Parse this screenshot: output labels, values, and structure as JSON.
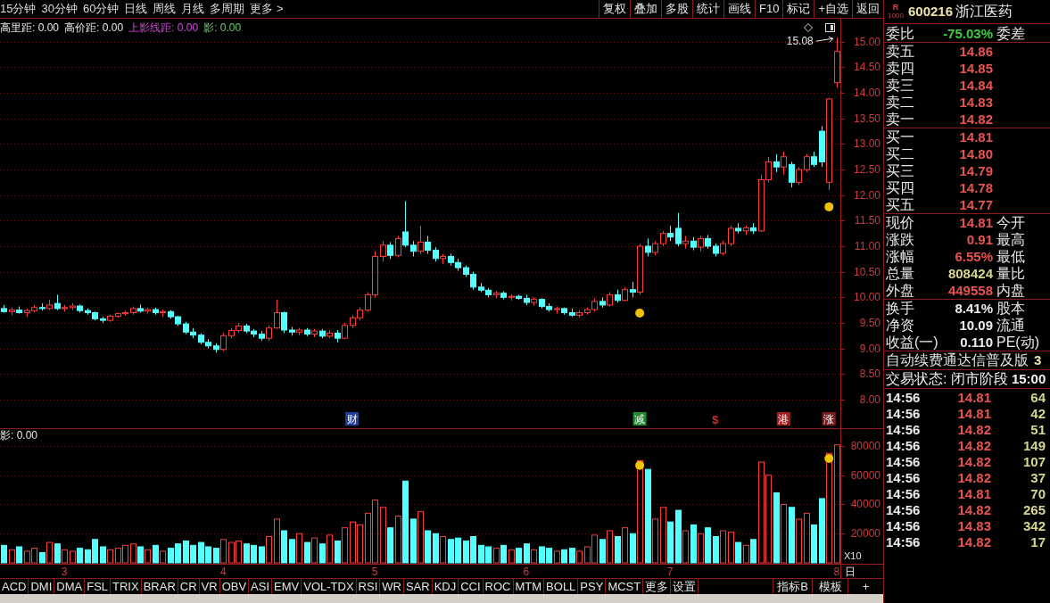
{
  "toolbar": {
    "period_tabs": [
      "15分钟",
      "30分钟",
      "60分钟",
      "日线",
      "周线",
      "月线",
      "多周期",
      "更多 >"
    ],
    "buttons": [
      "复权",
      "叠加",
      "多股",
      "统计",
      "画线",
      "F10",
      "标记",
      "+自选",
      "返回"
    ]
  },
  "indicator_line": [
    {
      "label": "高里距:",
      "value": "0.00",
      "color": "#e6e6e6"
    },
    {
      "label": "高价距:",
      "value": "0.00",
      "color": "#e6e6e6"
    },
    {
      "label": "上影线距:",
      "value": "0.00",
      "color": "#d048d8"
    },
    {
      "label": "影:",
      "value": "0.00",
      "color": "#6cc86c"
    }
  ],
  "volume_indicator": {
    "label": "影:",
    "value": "0.00"
  },
  "chart": {
    "chart_data": [
      {
        "type": "candlestick",
        "grid": true,
        "ylim": [
          7.44,
          15.45
        ],
        "yticks": [
          {
            "value": 8,
            "label": "8.00"
          },
          {
            "value": 8.5,
            "label": "8.50"
          },
          {
            "value": 9,
            "label": "9.00"
          },
          {
            "value": 9.5,
            "label": "9.50"
          },
          {
            "value": 10,
            "label": "10.00"
          },
          {
            "value": 10.5,
            "label": "10.50"
          },
          {
            "value": 11,
            "label": "11.00"
          },
          {
            "value": 11.5,
            "label": "11.50"
          },
          {
            "value": 12,
            "label": "12.00"
          },
          {
            "value": 12.5,
            "label": "12.50"
          },
          {
            "value": 13,
            "label": "13.00"
          },
          {
            "value": 13.5,
            "label": "13.50"
          },
          {
            "value": 14,
            "label": "14.00"
          },
          {
            "value": 14.5,
            "label": "14.50"
          },
          {
            "value": 15,
            "label": "15.00"
          }
        ],
        "categories": [
          null,
          null,
          null,
          null,
          null,
          null,
          null,
          null,
          null,
          null,
          null,
          null,
          null,
          null,
          null,
          null,
          null,
          null,
          null,
          null,
          null,
          null,
          null,
          null,
          null,
          null,
          null,
          null,
          null,
          null,
          null,
          null,
          null,
          null,
          null,
          null,
          null,
          null,
          null,
          null,
          null,
          null,
          null,
          null,
          null,
          null,
          "财",
          null,
          null,
          null,
          null,
          null,
          null,
          null,
          null,
          null,
          null,
          null,
          null,
          null,
          null,
          null,
          null,
          null,
          null,
          null,
          null,
          null,
          null,
          null,
          null,
          null,
          null,
          null,
          null,
          null,
          null,
          null,
          null,
          null,
          null,
          null,
          null,
          null,
          "减",
          null,
          null,
          null,
          null,
          null,
          null,
          null,
          null,
          null,
          "$",
          null,
          null,
          null,
          null,
          null,
          null,
          null,
          null,
          "港",
          null,
          null,
          null,
          null,
          null,
          "涨",
          null
        ],
        "ohlc": [
          [
            9.78,
            9.85,
            9.7,
            9.72
          ],
          [
            9.72,
            9.8,
            9.65,
            9.75
          ],
          [
            9.75,
            9.82,
            9.68,
            9.7
          ],
          [
            9.7,
            9.78,
            9.62,
            9.74
          ],
          [
            9.74,
            9.85,
            9.7,
            9.8
          ],
          [
            9.8,
            9.88,
            9.74,
            9.78
          ],
          [
            9.78,
            9.95,
            9.75,
            9.85
          ],
          [
            9.88,
            10.05,
            9.75,
            9.78
          ],
          [
            9.78,
            9.85,
            9.72,
            9.8
          ],
          [
            9.8,
            9.88,
            9.75,
            9.83
          ],
          [
            9.83,
            9.86,
            9.7,
            9.74
          ],
          [
            9.74,
            9.78,
            9.66,
            9.7
          ],
          [
            9.7,
            9.72,
            9.55,
            9.58
          ],
          [
            9.58,
            9.62,
            9.5,
            9.55
          ],
          [
            9.55,
            9.66,
            9.52,
            9.63
          ],
          [
            9.63,
            9.7,
            9.6,
            9.68
          ],
          [
            9.68,
            9.74,
            9.64,
            9.7
          ],
          [
            9.7,
            9.82,
            9.66,
            9.78
          ],
          [
            9.78,
            9.86,
            9.7,
            9.73
          ],
          [
            9.73,
            9.8,
            9.68,
            9.76
          ],
          [
            9.76,
            9.8,
            9.66,
            9.7
          ],
          [
            9.7,
            9.76,
            9.62,
            9.72
          ],
          [
            9.72,
            9.75,
            9.58,
            9.62
          ],
          [
            9.62,
            9.64,
            9.44,
            9.48
          ],
          [
            9.48,
            9.52,
            9.28,
            9.32
          ],
          [
            9.32,
            9.4,
            9.2,
            9.26
          ],
          [
            9.26,
            9.3,
            9.08,
            9.12
          ],
          [
            9.12,
            9.18,
            9.0,
            9.05
          ],
          [
            9.05,
            9.1,
            8.92,
            8.98
          ],
          [
            8.98,
            9.3,
            8.95,
            9.25
          ],
          [
            9.25,
            9.4,
            9.2,
            9.35
          ],
          [
            9.35,
            9.5,
            9.3,
            9.44
          ],
          [
            9.44,
            9.48,
            9.3,
            9.34
          ],
          [
            9.34,
            9.38,
            9.22,
            9.28
          ],
          [
            9.28,
            9.34,
            9.15,
            9.2
          ],
          [
            9.2,
            9.45,
            9.15,
            9.4
          ],
          [
            9.4,
            9.95,
            9.38,
            9.7
          ],
          [
            9.7,
            9.72,
            9.3,
            9.36
          ],
          [
            9.36,
            9.42,
            9.25,
            9.32
          ],
          [
            9.32,
            9.4,
            9.26,
            9.36
          ],
          [
            9.36,
            9.4,
            9.24,
            9.28
          ],
          [
            9.28,
            9.38,
            9.22,
            9.34
          ],
          [
            9.34,
            9.38,
            9.2,
            9.24
          ],
          [
            9.24,
            9.36,
            9.2,
            9.3
          ],
          [
            9.3,
            9.36,
            9.12,
            9.2
          ],
          [
            9.2,
            9.5,
            9.18,
            9.45
          ],
          [
            9.45,
            9.65,
            9.4,
            9.6
          ],
          [
            9.6,
            9.8,
            9.55,
            9.75
          ],
          [
            9.75,
            10.1,
            9.72,
            10.05
          ],
          [
            10.05,
            10.9,
            10.0,
            10.8
          ],
          [
            10.8,
            11.1,
            10.7,
            11.02
          ],
          [
            11.02,
            11.08,
            10.75,
            10.82
          ],
          [
            10.82,
            11.2,
            10.78,
            11.15
          ],
          [
            11.28,
            11.88,
            10.98,
            11.02
          ],
          [
            11.02,
            11.1,
            10.8,
            10.9
          ],
          [
            10.9,
            11.4,
            10.85,
            11.08
          ],
          [
            11.08,
            11.2,
            10.85,
            10.92
          ],
          [
            10.92,
            10.98,
            10.7,
            10.76
          ],
          [
            10.76,
            10.85,
            10.65,
            10.8
          ],
          [
            10.8,
            10.85,
            10.62,
            10.68
          ],
          [
            10.68,
            10.75,
            10.52,
            10.58
          ],
          [
            10.58,
            10.62,
            10.4,
            10.45
          ],
          [
            10.45,
            10.5,
            10.15,
            10.2
          ],
          [
            10.2,
            10.28,
            10.1,
            10.14
          ],
          [
            10.14,
            10.18,
            10.0,
            10.05
          ],
          [
            10.05,
            10.12,
            9.98,
            10.08
          ],
          [
            10.08,
            10.12,
            9.96,
            10.0
          ],
          [
            10.0,
            10.06,
            9.94,
            10.02
          ],
          [
            10.02,
            10.05,
            9.95,
            9.98
          ],
          [
            9.98,
            10.05,
            9.85,
            9.9
          ],
          [
            9.9,
            10.0,
            9.84,
            9.96
          ],
          [
            9.96,
            9.98,
            9.78,
            9.82
          ],
          [
            9.82,
            9.88,
            9.72,
            9.76
          ],
          [
            9.76,
            9.82,
            9.68,
            9.78
          ],
          [
            9.78,
            9.8,
            9.66,
            9.7
          ],
          [
            9.7,
            9.78,
            9.62,
            9.65
          ],
          [
            9.65,
            9.75,
            9.6,
            9.7
          ],
          [
            9.7,
            9.8,
            9.66,
            9.76
          ],
          [
            9.76,
            9.98,
            9.72,
            9.92
          ],
          [
            9.92,
            10.0,
            9.8,
            9.85
          ],
          [
            9.85,
            10.1,
            9.82,
            10.05
          ],
          [
            10.05,
            10.15,
            9.9,
            9.94
          ],
          [
            9.94,
            10.2,
            9.92,
            10.15
          ],
          [
            10.15,
            10.3,
            10.0,
            10.1
          ],
          [
            10.1,
            11.05,
            10.05,
            11.0
          ],
          [
            11.0,
            11.15,
            10.8,
            10.88
          ],
          [
            10.88,
            11.1,
            10.82,
            11.05
          ],
          [
            11.05,
            11.3,
            11.0,
            11.25
          ],
          [
            11.25,
            11.4,
            11.1,
            11.18
          ],
          [
            11.35,
            11.65,
            11.0,
            11.05
          ],
          [
            11.05,
            11.2,
            10.95,
            11.1
          ],
          [
            11.1,
            11.18,
            10.92,
            10.98
          ],
          [
            10.98,
            11.2,
            10.9,
            11.15
          ],
          [
            11.15,
            11.22,
            10.95,
            11.0
          ],
          [
            11.0,
            11.05,
            10.8,
            10.86
          ],
          [
            10.86,
            11.1,
            10.82,
            11.05
          ],
          [
            11.05,
            11.4,
            11.0,
            11.35
          ],
          [
            11.35,
            11.45,
            11.25,
            11.3
          ],
          [
            11.3,
            11.4,
            11.22,
            11.36
          ],
          [
            11.36,
            11.45,
            11.24,
            11.3
          ],
          [
            11.3,
            12.4,
            11.28,
            12.3
          ],
          [
            12.3,
            12.75,
            12.25,
            12.65
          ],
          [
            12.65,
            12.8,
            12.45,
            12.55
          ],
          [
            12.55,
            12.85,
            12.4,
            12.75
          ],
          [
            12.6,
            12.65,
            12.15,
            12.25
          ],
          [
            12.25,
            12.55,
            12.2,
            12.5
          ],
          [
            12.5,
            12.8,
            12.45,
            12.75
          ],
          [
            12.75,
            12.85,
            12.55,
            12.6
          ],
          [
            13.25,
            13.35,
            12.55,
            12.65
          ],
          [
            12.25,
            13.9,
            12.1,
            13.88
          ],
          [
            14.2,
            15.08,
            14.1,
            14.81
          ]
        ],
        "series": [
          {
            "type": "scatter",
            "marker": "circle",
            "color": "#f2c200",
            "values": [
              null,
              null,
              null,
              null,
              null,
              null,
              null,
              null,
              null,
              null,
              null,
              null,
              null,
              null,
              null,
              null,
              null,
              null,
              null,
              null,
              null,
              null,
              null,
              null,
              null,
              null,
              null,
              null,
              null,
              null,
              null,
              null,
              null,
              null,
              null,
              null,
              null,
              null,
              null,
              null,
              null,
              null,
              null,
              null,
              null,
              null,
              null,
              null,
              null,
              null,
              null,
              null,
              null,
              null,
              null,
              null,
              null,
              null,
              null,
              null,
              null,
              null,
              null,
              null,
              null,
              null,
              null,
              null,
              null,
              null,
              null,
              null,
              null,
              null,
              null,
              null,
              null,
              null,
              null,
              null,
              null,
              null,
              null,
              null,
              9.69,
              null,
              null,
              null,
              null,
              null,
              null,
              null,
              null,
              null,
              null,
              null,
              null,
              null,
              null,
              null,
              null,
              null,
              null,
              null,
              null,
              null,
              null,
              null,
              null,
              11.77,
              null
            ]
          }
        ],
        "annotations": [
          "15.08"
        ]
      },
      {
        "type": "bar",
        "grid": true,
        "ylim": [
          0,
          91603
        ],
        "ylabel": "X10",
        "yticks": [
          {
            "value": 20000,
            "label": "20000"
          },
          {
            "value": 40000,
            "label": "40000"
          },
          {
            "value": 60000,
            "label": "60000"
          },
          {
            "value": 80000,
            "label": "80000"
          }
        ],
        "categories": [
          null,
          null,
          null,
          null,
          null,
          null,
          null,
          null,
          "3",
          null,
          null,
          null,
          null,
          null,
          null,
          null,
          null,
          null,
          null,
          null,
          null,
          null,
          null,
          null,
          null,
          null,
          null,
          null,
          null,
          "4",
          null,
          null,
          null,
          null,
          null,
          null,
          null,
          null,
          null,
          null,
          null,
          null,
          null,
          null,
          null,
          null,
          null,
          null,
          null,
          "5",
          null,
          null,
          null,
          null,
          null,
          null,
          null,
          null,
          null,
          null,
          null,
          null,
          null,
          null,
          null,
          null,
          null,
          null,
          null,
          "6",
          null,
          null,
          null,
          null,
          null,
          null,
          null,
          null,
          null,
          null,
          null,
          null,
          null,
          null,
          null,
          null,
          null,
          null,
          "7",
          null,
          null,
          null,
          null,
          null,
          null,
          null,
          null,
          null,
          null,
          null,
          null,
          null,
          null,
          null,
          null,
          null,
          null,
          null,
          null,
          null,
          "8"
        ],
        "values": [
          12000,
          9000,
          11000,
          8000,
          10000,
          7000,
          14000,
          13000,
          9000,
          8000,
          10000,
          9000,
          16000,
          11000,
          9000,
          10000,
          12000,
          13000,
          11000,
          9000,
          12000,
          8000,
          10000,
          13000,
          15000,
          12000,
          14000,
          11000,
          10000,
          16000,
          14000,
          15000,
          13000,
          12000,
          11000,
          18000,
          30000,
          22000,
          16000,
          20000,
          14000,
          17000,
          13000,
          19000,
          15000,
          24000,
          28000,
          26000,
          34000,
          43000,
          38000,
          24000,
          32000,
          56000,
          30000,
          35000,
          22000,
          20000,
          18000,
          16000,
          17000,
          15000,
          18000,
          12000,
          11000,
          10000,
          12000,
          9000,
          10000,
          13000,
          9000,
          11000,
          10000,
          8000,
          9000,
          10000,
          8000,
          11000,
          19000,
          16000,
          22000,
          18000,
          24000,
          20000,
          70000,
          64000,
          30000,
          38000,
          28000,
          36000,
          22000,
          26000,
          20000,
          24000,
          18000,
          22000,
          21000,
          14000,
          12000,
          16000,
          69000,
          60000,
          48000,
          40000,
          38000,
          30000,
          34000,
          26000,
          44000,
          75000,
          80800
        ],
        "colors": [
          "#54ffff",
          "#ff3c3c",
          "#54ffff",
          "#ff3c3c",
          "#ff3c3c",
          "#54ffff",
          "#ff3c3c",
          "#54ffff",
          "#ff3c3c",
          "#ff3c3c",
          "#54ffff",
          "#54ffff",
          "#54ffff",
          "#54ffff",
          "#ff3c3c",
          "#ff3c3c",
          "#ff3c3c",
          "#ff3c3c",
          "#54ffff",
          "#ff3c3c",
          "#54ffff",
          "#ff3c3c",
          "#54ffff",
          "#54ffff",
          "#54ffff",
          "#54ffff",
          "#54ffff",
          "#54ffff",
          "#54ffff",
          "#ff3c3c",
          "#ff3c3c",
          "#ff3c3c",
          "#54ffff",
          "#54ffff",
          "#54ffff",
          "#ff3c3c",
          "#ff3c3c",
          "#54ffff",
          "#54ffff",
          "#ff3c3c",
          "#54ffff",
          "#ff3c3c",
          "#54ffff",
          "#ff3c3c",
          "#54ffff",
          "#ff3c3c",
          "#ff3c3c",
          "#ff3c3c",
          "#ff3c3c",
          "#ff3c3c",
          "#ff3c3c",
          "#54ffff",
          "#ff3c3c",
          "#54ffff",
          "#54ffff",
          "#ff3c3c",
          "#54ffff",
          "#54ffff",
          "#ff3c3c",
          "#54ffff",
          "#54ffff",
          "#54ffff",
          "#54ffff",
          "#54ffff",
          "#54ffff",
          "#ff3c3c",
          "#54ffff",
          "#ff3c3c",
          "#54ffff",
          "#54ffff",
          "#ff3c3c",
          "#54ffff",
          "#54ffff",
          "#ff3c3c",
          "#54ffff",
          "#54ffff",
          "#ff3c3c",
          "#ff3c3c",
          "#ff3c3c",
          "#54ffff",
          "#ff3c3c",
          "#54ffff",
          "#ff3c3c",
          "#54ffff",
          "#ff3c3c",
          "#54ffff",
          "#ff3c3c",
          "#ff3c3c",
          "#54ffff",
          "#54ffff",
          "#ff3c3c",
          "#54ffff",
          "#ff3c3c",
          "#54ffff",
          "#54ffff",
          "#ff3c3c",
          "#ff3c3c",
          "#54ffff",
          "#ff3c3c",
          "#54ffff",
          "#ff3c3c",
          "#ff3c3c",
          "#54ffff",
          "#ff3c3c",
          "#54ffff",
          "#ff3c3c",
          "#ff3c3c",
          "#54ffff",
          "#54ffff",
          "#ff3c3c",
          "#ff3c3c"
        ],
        "series": [
          {
            "type": "scatter",
            "marker": "circle",
            "color": "#f2c200",
            "values": [
              null,
              null,
              null,
              null,
              null,
              null,
              null,
              null,
              null,
              null,
              null,
              null,
              null,
              null,
              null,
              null,
              null,
              null,
              null,
              null,
              null,
              null,
              null,
              null,
              null,
              null,
              null,
              null,
              null,
              null,
              null,
              null,
              null,
              null,
              null,
              null,
              null,
              null,
              null,
              null,
              null,
              null,
              null,
              null,
              null,
              null,
              null,
              null,
              null,
              null,
              null,
              null,
              null,
              null,
              null,
              null,
              null,
              null,
              null,
              null,
              null,
              null,
              null,
              null,
              null,
              null,
              null,
              null,
              null,
              null,
              null,
              null,
              null,
              null,
              null,
              null,
              null,
              null,
              null,
              null,
              null,
              null,
              null,
              null,
              66700,
              null,
              null,
              null,
              null,
              null,
              null,
              null,
              null,
              null,
              null,
              null,
              null,
              null,
              null,
              null,
              null,
              null,
              null,
              null,
              null,
              null,
              null,
              null,
              null,
              71500,
              null
            ]
          }
        ]
      }
    ]
  },
  "event_marks": [
    {
      "kind": "badge",
      "color": "#1c3f9c"
    },
    {
      "kind": "badge",
      "color": "#1d8a2c"
    },
    {
      "kind": "glyph",
      "color": "#d42a2a"
    },
    {
      "kind": "badge",
      "color": "#a61c1c"
    },
    {
      "kind": "badge",
      "color": "#7a1a1a"
    }
  ],
  "period_label": "日",
  "indicator_tabs": [
    "ACD",
    "DMI",
    "DMA",
    "FSL",
    "TRIX",
    "BRAR",
    "CR",
    "VR",
    "OBV",
    "ASI",
    "EMV",
    "VOL-TDX",
    "RSI",
    "WR",
    "SAR",
    "KDJ",
    "CCI",
    "ROC",
    "MTM",
    "BOLL",
    "PSY",
    "MCST",
    "更多",
    "设置"
  ],
  "template_buttons": [
    "指标B",
    "模板",
    "+"
  ],
  "quote": {
    "badge_letter": "R",
    "badge_number": "1000",
    "code": "600216",
    "name": "浙江医药"
  },
  "order_ratio": {
    "label": "委比",
    "value": "-75.03%",
    "label2": "委差"
  },
  "asks": [
    {
      "label": "卖五",
      "price": "14.86"
    },
    {
      "label": "卖四",
      "price": "14.85"
    },
    {
      "label": "卖三",
      "price": "14.84"
    },
    {
      "label": "卖二",
      "price": "14.83"
    },
    {
      "label": "卖一",
      "price": "14.82"
    }
  ],
  "bids": [
    {
      "label": "买一",
      "price": "14.81"
    },
    {
      "label": "买二",
      "price": "14.80"
    },
    {
      "label": "买三",
      "price": "14.79"
    },
    {
      "label": "买四",
      "price": "14.78"
    },
    {
      "label": "买五",
      "price": "14.77"
    }
  ],
  "stats": [
    {
      "label": "现价",
      "value": "14.81",
      "label2": "今开",
      "color": "#e8534f"
    },
    {
      "label": "涨跌",
      "value": "0.91",
      "label2": "最高",
      "color": "#e8534f"
    },
    {
      "label": "涨幅",
      "value": "6.55%",
      "label2": "最低",
      "color": "#e8534f"
    },
    {
      "label": "总量",
      "value": "808424",
      "label2": "量比",
      "color": "#d6d68c"
    },
    {
      "label": "外盘",
      "value": "449558",
      "label2": "内盘",
      "color": "#e8534f"
    }
  ],
  "fundamentals": [
    {
      "label": "换手",
      "value": "8.41%",
      "label2": "股本"
    },
    {
      "label": "净资",
      "value": "10.09",
      "label2": "流通"
    },
    {
      "label": "收益(一)",
      "value": "0.110",
      "label2": "PE(动)"
    }
  ],
  "banner": {
    "text": "自动续费通达信普及版",
    "tail": "3"
  },
  "trade_status": {
    "text": "交易状态: 闭市阶段",
    "time": "15:00"
  },
  "ticks": [
    {
      "time": "14:56",
      "price": "14.81",
      "volume": "64"
    },
    {
      "time": "14:56",
      "price": "14.81",
      "volume": "42"
    },
    {
      "time": "14:56",
      "price": "14.82",
      "volume": "51"
    },
    {
      "time": "14:56",
      "price": "14.82",
      "volume": "149"
    },
    {
      "time": "14:56",
      "price": "14.82",
      "volume": "107"
    },
    {
      "time": "14:56",
      "price": "14.82",
      "volume": "37"
    },
    {
      "time": "14:56",
      "price": "14.81",
      "volume": "70"
    },
    {
      "time": "14:56",
      "price": "14.82",
      "volume": "265"
    },
    {
      "time": "14:56",
      "price": "14.83",
      "volume": "342"
    },
    {
      "time": "14:56",
      "price": "14.82",
      "volume": "17"
    }
  ]
}
